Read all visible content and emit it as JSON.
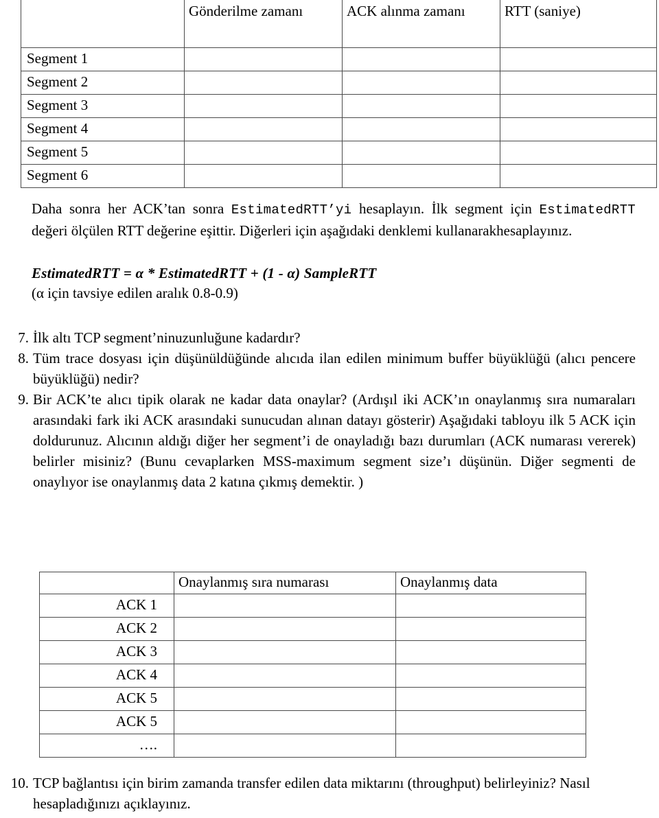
{
  "segment_table": {
    "headers": [
      "",
      "Gönderilme zamanı",
      "ACK alınma zamanı",
      "RTT (saniye)"
    ],
    "rows": [
      {
        "label": "Segment 1",
        "sent": "",
        "ack": "",
        "rtt": ""
      },
      {
        "label": "Segment 2",
        "sent": "",
        "ack": "",
        "rtt": ""
      },
      {
        "label": "Segment 3",
        "sent": "",
        "ack": "",
        "rtt": ""
      },
      {
        "label": "Segment 4",
        "sent": "",
        "ack": "",
        "rtt": ""
      },
      {
        "label": "Segment 5",
        "sent": "",
        "ack": "",
        "rtt": ""
      },
      {
        "label": "Segment 6",
        "sent": "",
        "ack": "",
        "rtt": ""
      }
    ]
  },
  "paragraph": {
    "part1": "Daha sonra her ACK’tan sonra ",
    "mono1": "EstimatedRTT’yi",
    "part2": " hesaplayın. İlk segment için ",
    "mono2": "EstimatedRTT",
    "part3": " değeri ölçülen RTT değerine eşittir. Diğerleri için aşağıdaki denklemi kullanarakhesaplayınız.",
    "equation": "EstimatedRTT = α * EstimatedRTT + (1 - α) SampleRTT",
    "alpha_note": "(α için tavsiye edilen aralık 0.8-0.9)"
  },
  "questions_top": [
    {
      "num": "7.",
      "text": "İlk altı TCP segment’ninuzunluğune kadardır?"
    },
    {
      "num": "8.",
      "text": "Tüm trace dosyası için düşünüldüğünde alıcıda ilan edilen minimum buffer büyüklüğü (alıcı pencere büyüklüğü) nedir?"
    },
    {
      "num": "9.",
      "text": "Bir ACK’te alıcı tipik olarak ne kadar data onaylar? (Ardışıl iki ACK’ın onaylanmış sıra numaraları arasındaki fark iki ACK arasındaki sunucudan alınan datayı gösterir) Aşağıdaki tabloyu ilk 5 ACK için doldurunuz. Alıcının aldığı diğer her segment’i de onayladığı bazı durumları (ACK numarası vererek) belirler misiniz? (Bunu cevaplarken MSS-maximum segment size’ı düşünün. Diğer segmenti de onaylıyor ise onaylanmış data 2 katına çıkmış demektir. )"
    }
  ],
  "ack_table": {
    "headers": [
      "",
      "Onaylanmış sıra numarası",
      "Onaylanmış data"
    ],
    "rows": [
      {
        "label": "ACK 1",
        "seq": "",
        "data": ""
      },
      {
        "label": "ACK 2",
        "seq": "",
        "data": ""
      },
      {
        "label": "ACK 3",
        "seq": "",
        "data": ""
      },
      {
        "label": "ACK 4",
        "seq": "",
        "data": ""
      },
      {
        "label": "ACK 5",
        "seq": "",
        "data": ""
      },
      {
        "label": "ACK 5",
        "seq": "",
        "data": ""
      },
      {
        "label": "….",
        "seq": "",
        "data": ""
      }
    ]
  },
  "questions_bottom": [
    {
      "num": "10.",
      "text": "TCP bağlantısı için birim zamanda transfer edilen data miktarını (throughput) belirleyiniz? Nasıl hesapladığınızı açıklayınız."
    }
  ]
}
